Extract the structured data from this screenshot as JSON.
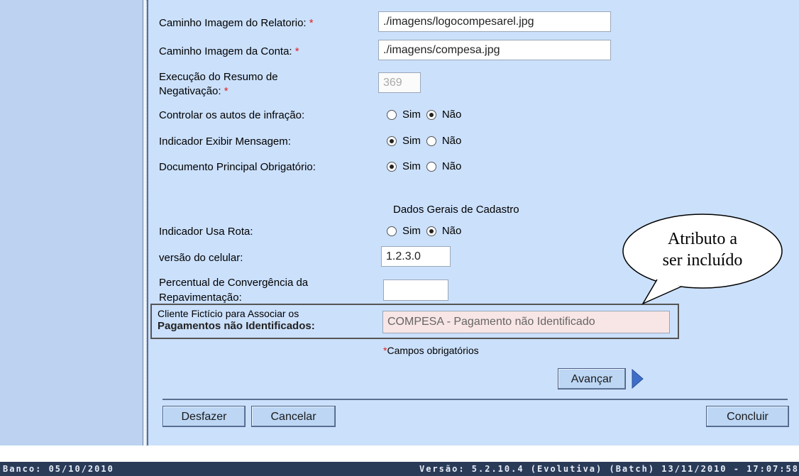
{
  "form": {
    "caminho_relatorio": {
      "label": "Caminho Imagem do Relatorio:",
      "required_mark": "*",
      "value": "./imagens/logocompesarel.jpg"
    },
    "caminho_conta": {
      "label": "Caminho Imagem da Conta:",
      "required_mark": "*",
      "value": "./imagens/compesa.jpg"
    },
    "execucao_resumo": {
      "label_line1": "Execução do Resumo de",
      "label_line2": "Negativação:",
      "required_mark": "*",
      "value": "369"
    },
    "controlar_autos": {
      "label": "Controlar os autos de infração:",
      "opt_sim": "Sim",
      "opt_nao": "Não",
      "selected": "Não"
    },
    "exibir_mensagem": {
      "label": "Indicador Exibir Mensagem:",
      "opt_sim": "Sim",
      "opt_nao": "Não",
      "selected": "Sim"
    },
    "doc_principal": {
      "label": "Documento Principal Obrigatório:",
      "opt_sim": "Sim",
      "opt_nao": "Não",
      "selected": "Sim"
    },
    "section_cadastro": "Dados Gerais de Cadastro",
    "usa_rota": {
      "label": "Indicador Usa Rota:",
      "opt_sim": "Sim",
      "opt_nao": "Não",
      "selected": "Não"
    },
    "versao_celular": {
      "label": "versão do celular:",
      "value": "1.2.3.0"
    },
    "percentual": {
      "label_line1": "Percentual de Convergência da",
      "label_line2": "Repavimentação:",
      "value": ""
    },
    "cliente_ficticio": {
      "label_line1": "Cliente Fictício para Associar os",
      "label_line2": "Pagamentos não Identificados:",
      "value": "COMPESA - Pagamento não Identificado"
    },
    "campos_obrigatorios": {
      "mark": "*",
      "text": "Campos obrigatórios"
    }
  },
  "buttons": {
    "avancar": "Avançar",
    "desfazer": "Desfazer",
    "cancelar": "Cancelar",
    "concluir": "Concluir"
  },
  "callout": {
    "line1": "Atributo a",
    "line2": "ser incluído"
  },
  "footer": {
    "banco": "Banco: 05/10/2010",
    "versao": "Versão: 5.2.10.4 (Evolutiva) (Batch) 13/11/2010 - 17:07:58"
  }
}
